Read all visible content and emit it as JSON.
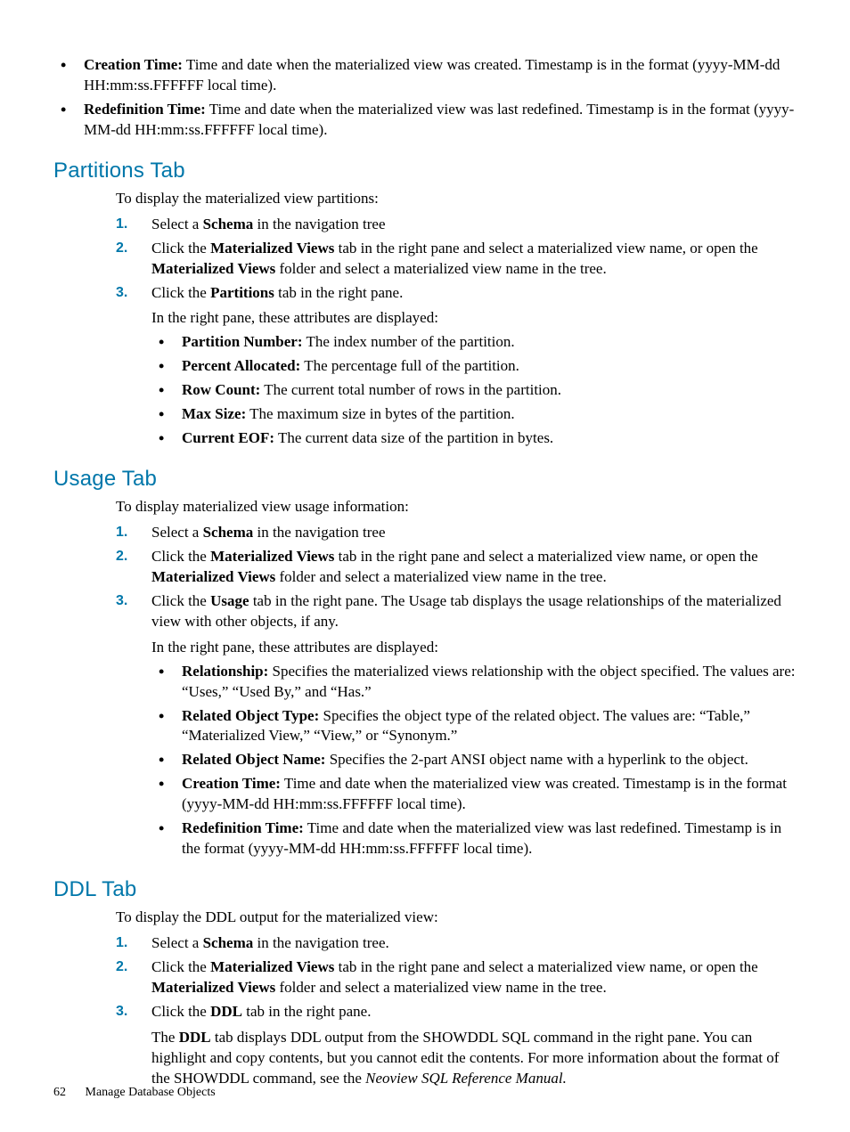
{
  "continued": {
    "bullets": [
      {
        "label": "Creation Time:",
        "text": " Time and date when the materialized view was created. Timestamp is in the format (yyyy-MM-dd HH:mm:ss.FFFFFF local time)."
      },
      {
        "label": "Redefinition Time:",
        "text": " Time and date when the materialized view was last redefined. Timestamp is in the format (yyyy-MM-dd HH:mm:ss.FFFFFF local time)."
      }
    ]
  },
  "partitions": {
    "heading": "Partitions Tab",
    "intro": "To display the materialized view partitions:",
    "step1": {
      "pre": "Select a ",
      "b1": "Schema",
      "post": " in the navigation tree"
    },
    "step2": {
      "pre": "Click the ",
      "b1": "Materialized Views",
      "mid": " tab in the right pane and select a materialized view name, or open the ",
      "b2": "Materialized Views",
      "post": " folder and select a materialized view name in the tree."
    },
    "step3": {
      "pre": "Click the ",
      "b1": "Partitions",
      "post": " tab in the right pane.",
      "sub": "In the right pane, these attributes are displayed:"
    },
    "attrs": [
      {
        "label": "Partition Number:",
        "text": " The index number of the partition."
      },
      {
        "label": "Percent Allocated:",
        "text": " The percentage full of the partition."
      },
      {
        "label": "Row Count:",
        "text": " The current total number of rows in the partition."
      },
      {
        "label": "Max Size:",
        "text": " The maximum size in bytes of the partition."
      },
      {
        "label": "Current EOF:",
        "text": " The current data size of the partition in bytes."
      }
    ]
  },
  "usage": {
    "heading": "Usage Tab",
    "intro": "To display materialized view usage information:",
    "step1": {
      "pre": "Select a ",
      "b1": "Schema",
      "post": " in the navigation tree"
    },
    "step2": {
      "pre": "Click the ",
      "b1": "Materialized Views",
      "mid": " tab in the right pane and select a materialized view name, or open the ",
      "b2": "Materialized Views",
      "post": " folder and select a materialized view name in the tree."
    },
    "step3": {
      "pre": "Click the ",
      "b1": "Usage",
      "post": " tab in the right pane. The Usage tab displays the usage relationships of the materialized view with other objects, if any.",
      "sub": "In the right pane, these attributes are displayed:"
    },
    "attrs": [
      {
        "label": "Relationship:",
        "text": " Specifies the materialized views relationship with the object specified. The values are: “Uses,” “Used By,” and “Has.”"
      },
      {
        "label": "Related Object Type:",
        "text": " Specifies the object type of the related object. The values are: “Table,” “Materialized View,” “View,” or “Synonym.”"
      },
      {
        "label": "Related Object Name:",
        "text": " Specifies the 2-part ANSI object name with a hyperlink to the object."
      },
      {
        "label": "Creation Time:",
        "text": " Time and date when the materialized view was created. Timestamp is in the format (yyyy-MM-dd HH:mm:ss.FFFFFF local time)."
      },
      {
        "label": "Redefinition Time:",
        "text": " Time and date when the materialized view was last redefined. Timestamp is in the format (yyyy-MM-dd HH:mm:ss.FFFFFF local time)."
      }
    ]
  },
  "ddl": {
    "heading": "DDL Tab",
    "intro": "To display the DDL output for the materialized view:",
    "step1": {
      "pre": "Select a ",
      "b1": "Schema",
      "post": " in the navigation tree."
    },
    "step2": {
      "pre": "Click the ",
      "b1": "Materialized Views",
      "mid": " tab in the right pane and select a materialized view name, or open the ",
      "b2": "Materialized Views",
      "post": " folder and select a materialized view name in the tree."
    },
    "step3": {
      "pre": "Click the ",
      "b1": "DDL",
      "post": " tab in the right pane.",
      "para_pre": "The ",
      "para_b": "DDL",
      "para_mid": " tab displays DDL output from the SHOWDDL SQL command in the right pane. You can highlight and copy contents, but you cannot edit the contents. For more information about the format of the SHOWDDL command, see the ",
      "para_i": "Neoview SQL Reference Manual."
    }
  },
  "footer": {
    "page": "62",
    "title": "Manage Database Objects"
  }
}
